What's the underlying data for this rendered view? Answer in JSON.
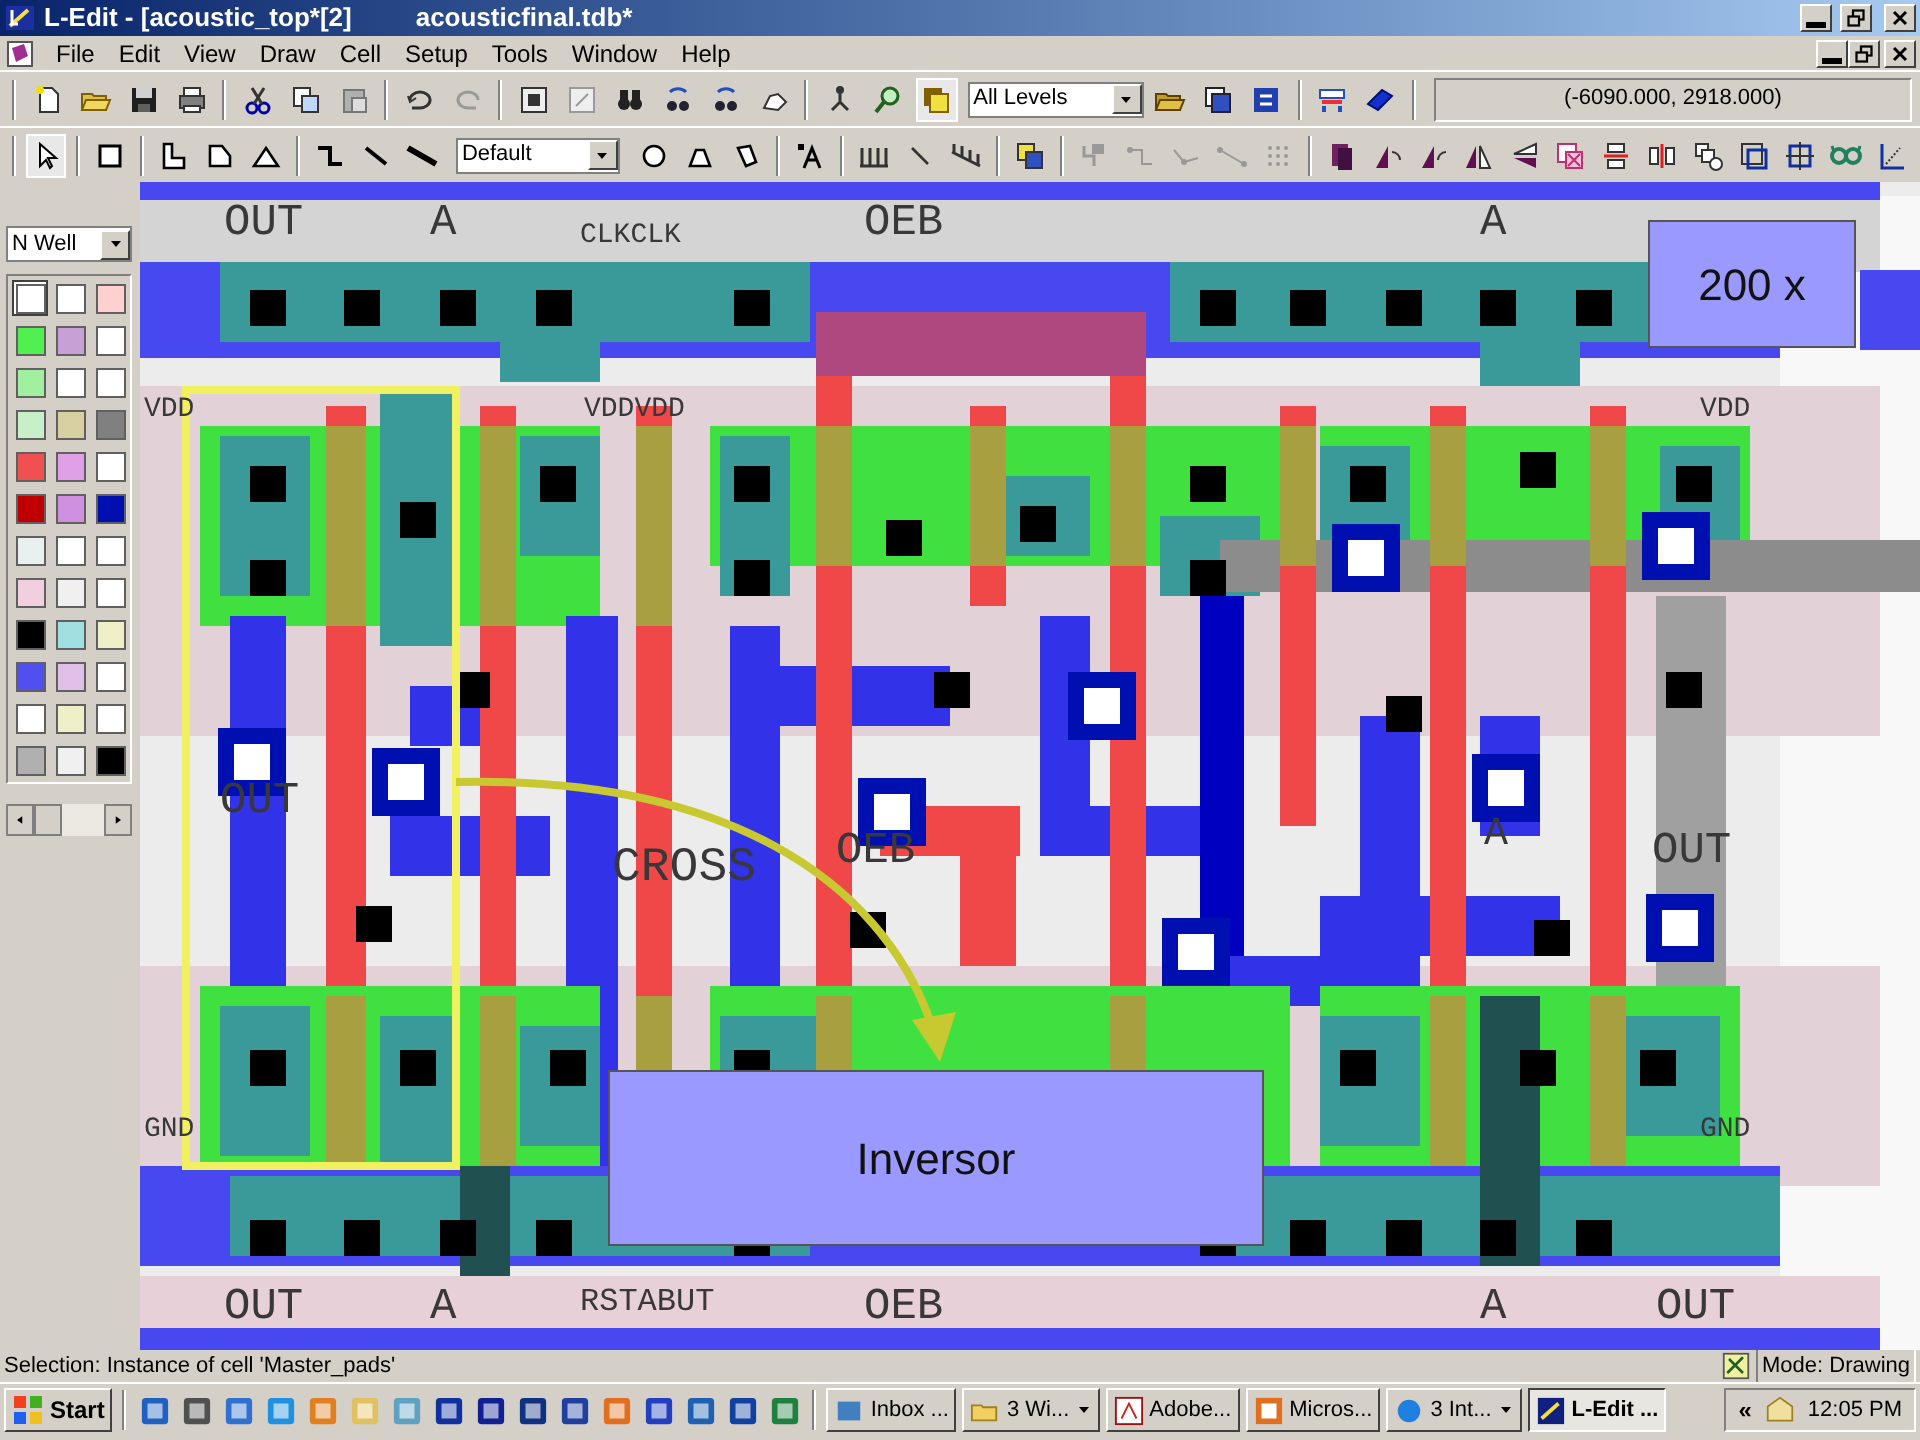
{
  "window": {
    "title": "L-Edit - [acoustic_top*[2]",
    "file": "acousticfinal.tdb*"
  },
  "menu": [
    "File",
    "Edit",
    "View",
    "Draw",
    "Cell",
    "Setup",
    "Tools",
    "Window",
    "Help"
  ],
  "toolbar": {
    "level_filter": "All Levels",
    "coordinates": "(-6090.000, 2918.000)"
  },
  "drawing_toolbar": {
    "style": "Default"
  },
  "layer_palette": {
    "layer": "N Well",
    "swatches": [
      {
        "color": "#ffffff",
        "selected": true
      },
      {
        "color": "#ffffff",
        "selected": false
      },
      {
        "color": "#ffd0d0",
        "selected": false
      },
      {
        "color": "#50f050",
        "selected": false
      },
      {
        "color": "#c8a0d8",
        "selected": false
      },
      {
        "color": "#ffffff",
        "selected": false
      },
      {
        "color": "#a0f0a0",
        "selected": false
      },
      {
        "color": "#ffffff",
        "selected": false
      },
      {
        "color": "#ffffff",
        "selected": false
      },
      {
        "color": "#c8f0c8",
        "selected": false
      },
      {
        "color": "#d8d0a0",
        "selected": false
      },
      {
        "color": "#808080",
        "selected": false
      },
      {
        "color": "#f05050",
        "selected": false
      },
      {
        "color": "#e0a0e8",
        "selected": false
      },
      {
        "color": "#ffffff",
        "selected": false
      },
      {
        "color": "#c00000",
        "selected": false
      },
      {
        "color": "#d090e0",
        "selected": false
      },
      {
        "color": "#0010b0",
        "selected": false
      },
      {
        "color": "#e8f0f0",
        "selected": false
      },
      {
        "color": "#ffffff",
        "selected": false
      },
      {
        "color": "#ffffff",
        "selected": false
      },
      {
        "color": "#f0d0e0",
        "selected": false
      },
      {
        "color": "#f0f0f0",
        "selected": false
      },
      {
        "color": "#ffffff",
        "selected": false
      },
      {
        "color": "#000000",
        "selected": false
      },
      {
        "color": "#a0e0e0",
        "selected": false
      },
      {
        "color": "#f0f0c8",
        "selected": false
      },
      {
        "color": "#5050f0",
        "selected": false
      },
      {
        "color": "#e0c0e8",
        "selected": false
      },
      {
        "color": "#ffffff",
        "selected": false
      },
      {
        "color": "#ffffff",
        "selected": false
      },
      {
        "color": "#f0f0c8",
        "selected": false
      },
      {
        "color": "#ffffff",
        "selected": false
      },
      {
        "color": "#b0b0b0",
        "selected": false
      },
      {
        "color": "#f0f0f0",
        "selected": false
      },
      {
        "color": "#000000",
        "selected": false
      }
    ]
  },
  "layout": {
    "labels": [
      "OUT",
      "A",
      "CLKCLK",
      "OEB",
      "A",
      "VDD",
      "VDDVDD",
      "VDD",
      "OUT",
      "CROSS",
      "OEB",
      "A",
      "OUT",
      "GND",
      "GND",
      "OUT",
      "A",
      "RSTABUT",
      "OEB",
      "A",
      "OUT"
    ]
  },
  "callouts": [
    "200 x",
    "Inversor"
  ],
  "status_bar": {
    "selection": "Selection: Instance of cell 'Master_pads'",
    "mode": "Mode: Drawing"
  },
  "taskbar": {
    "start": "Start",
    "tasks": [
      {
        "label": "Inbox ...",
        "grouped": false,
        "selected": false
      },
      {
        "label": "3 Wi...",
        "grouped": true,
        "selected": false
      },
      {
        "label": "Adobe...",
        "grouped": false,
        "selected": false
      },
      {
        "label": "Micros...",
        "grouped": false,
        "selected": false
      },
      {
        "label": "3 Int...",
        "grouped": true,
        "selected": false
      },
      {
        "label": "L-Edit ...",
        "grouped": false,
        "selected": true
      }
    ],
    "tray_expand": "«",
    "clock": "12:05 PM"
  }
}
